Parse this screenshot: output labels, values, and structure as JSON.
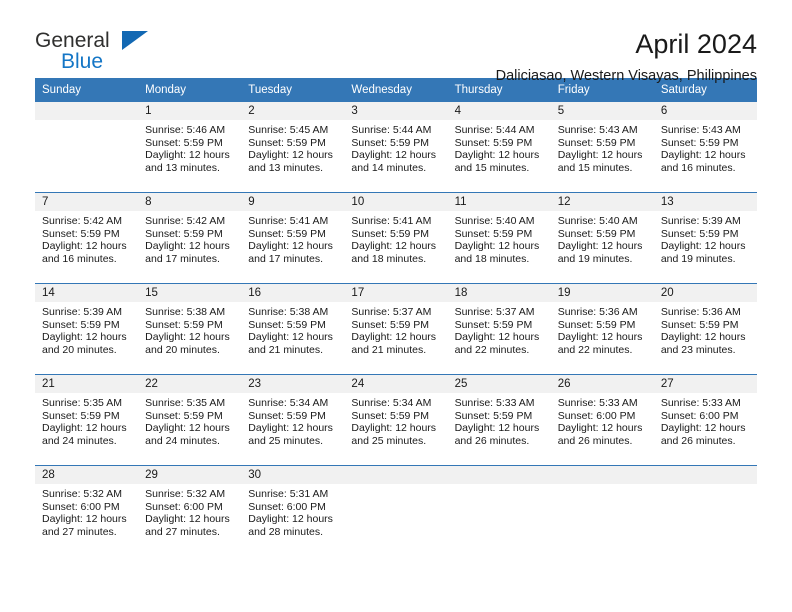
{
  "brand": {
    "name_top": "General",
    "name_bottom": "Blue",
    "accent_color": "#1476c6",
    "triangle_color": "#1268b3"
  },
  "header": {
    "title": "April 2024",
    "subtitle": "Daliciasao, Western Visayas, Philippines"
  },
  "calendar": {
    "header_bg": "#3477b6",
    "daynum_bg": "#f1f1f1",
    "weekday_headers": [
      "Sunday",
      "Monday",
      "Tuesday",
      "Wednesday",
      "Thursday",
      "Friday",
      "Saturday"
    ],
    "weeks": [
      [
        {
          "day": "",
          "sunrise": "",
          "sunset": "",
          "daylight1": "",
          "daylight2": ""
        },
        {
          "day": "1",
          "sunrise": "Sunrise: 5:46 AM",
          "sunset": "Sunset: 5:59 PM",
          "daylight1": "Daylight: 12 hours",
          "daylight2": "and 13 minutes."
        },
        {
          "day": "2",
          "sunrise": "Sunrise: 5:45 AM",
          "sunset": "Sunset: 5:59 PM",
          "daylight1": "Daylight: 12 hours",
          "daylight2": "and 13 minutes."
        },
        {
          "day": "3",
          "sunrise": "Sunrise: 5:44 AM",
          "sunset": "Sunset: 5:59 PM",
          "daylight1": "Daylight: 12 hours",
          "daylight2": "and 14 minutes."
        },
        {
          "day": "4",
          "sunrise": "Sunrise: 5:44 AM",
          "sunset": "Sunset: 5:59 PM",
          "daylight1": "Daylight: 12 hours",
          "daylight2": "and 15 minutes."
        },
        {
          "day": "5",
          "sunrise": "Sunrise: 5:43 AM",
          "sunset": "Sunset: 5:59 PM",
          "daylight1": "Daylight: 12 hours",
          "daylight2": "and 15 minutes."
        },
        {
          "day": "6",
          "sunrise": "Sunrise: 5:43 AM",
          "sunset": "Sunset: 5:59 PM",
          "daylight1": "Daylight: 12 hours",
          "daylight2": "and 16 minutes."
        }
      ],
      [
        {
          "day": "7",
          "sunrise": "Sunrise: 5:42 AM",
          "sunset": "Sunset: 5:59 PM",
          "daylight1": "Daylight: 12 hours",
          "daylight2": "and 16 minutes."
        },
        {
          "day": "8",
          "sunrise": "Sunrise: 5:42 AM",
          "sunset": "Sunset: 5:59 PM",
          "daylight1": "Daylight: 12 hours",
          "daylight2": "and 17 minutes."
        },
        {
          "day": "9",
          "sunrise": "Sunrise: 5:41 AM",
          "sunset": "Sunset: 5:59 PM",
          "daylight1": "Daylight: 12 hours",
          "daylight2": "and 17 minutes."
        },
        {
          "day": "10",
          "sunrise": "Sunrise: 5:41 AM",
          "sunset": "Sunset: 5:59 PM",
          "daylight1": "Daylight: 12 hours",
          "daylight2": "and 18 minutes."
        },
        {
          "day": "11",
          "sunrise": "Sunrise: 5:40 AM",
          "sunset": "Sunset: 5:59 PM",
          "daylight1": "Daylight: 12 hours",
          "daylight2": "and 18 minutes."
        },
        {
          "day": "12",
          "sunrise": "Sunrise: 5:40 AM",
          "sunset": "Sunset: 5:59 PM",
          "daylight1": "Daylight: 12 hours",
          "daylight2": "and 19 minutes."
        },
        {
          "day": "13",
          "sunrise": "Sunrise: 5:39 AM",
          "sunset": "Sunset: 5:59 PM",
          "daylight1": "Daylight: 12 hours",
          "daylight2": "and 19 minutes."
        }
      ],
      [
        {
          "day": "14",
          "sunrise": "Sunrise: 5:39 AM",
          "sunset": "Sunset: 5:59 PM",
          "daylight1": "Daylight: 12 hours",
          "daylight2": "and 20 minutes."
        },
        {
          "day": "15",
          "sunrise": "Sunrise: 5:38 AM",
          "sunset": "Sunset: 5:59 PM",
          "daylight1": "Daylight: 12 hours",
          "daylight2": "and 20 minutes."
        },
        {
          "day": "16",
          "sunrise": "Sunrise: 5:38 AM",
          "sunset": "Sunset: 5:59 PM",
          "daylight1": "Daylight: 12 hours",
          "daylight2": "and 21 minutes."
        },
        {
          "day": "17",
          "sunrise": "Sunrise: 5:37 AM",
          "sunset": "Sunset: 5:59 PM",
          "daylight1": "Daylight: 12 hours",
          "daylight2": "and 21 minutes."
        },
        {
          "day": "18",
          "sunrise": "Sunrise: 5:37 AM",
          "sunset": "Sunset: 5:59 PM",
          "daylight1": "Daylight: 12 hours",
          "daylight2": "and 22 minutes."
        },
        {
          "day": "19",
          "sunrise": "Sunrise: 5:36 AM",
          "sunset": "Sunset: 5:59 PM",
          "daylight1": "Daylight: 12 hours",
          "daylight2": "and 22 minutes."
        },
        {
          "day": "20",
          "sunrise": "Sunrise: 5:36 AM",
          "sunset": "Sunset: 5:59 PM",
          "daylight1": "Daylight: 12 hours",
          "daylight2": "and 23 minutes."
        }
      ],
      [
        {
          "day": "21",
          "sunrise": "Sunrise: 5:35 AM",
          "sunset": "Sunset: 5:59 PM",
          "daylight1": "Daylight: 12 hours",
          "daylight2": "and 24 minutes."
        },
        {
          "day": "22",
          "sunrise": "Sunrise: 5:35 AM",
          "sunset": "Sunset: 5:59 PM",
          "daylight1": "Daylight: 12 hours",
          "daylight2": "and 24 minutes."
        },
        {
          "day": "23",
          "sunrise": "Sunrise: 5:34 AM",
          "sunset": "Sunset: 5:59 PM",
          "daylight1": "Daylight: 12 hours",
          "daylight2": "and 25 minutes."
        },
        {
          "day": "24",
          "sunrise": "Sunrise: 5:34 AM",
          "sunset": "Sunset: 5:59 PM",
          "daylight1": "Daylight: 12 hours",
          "daylight2": "and 25 minutes."
        },
        {
          "day": "25",
          "sunrise": "Sunrise: 5:33 AM",
          "sunset": "Sunset: 5:59 PM",
          "daylight1": "Daylight: 12 hours",
          "daylight2": "and 26 minutes."
        },
        {
          "day": "26",
          "sunrise": "Sunrise: 5:33 AM",
          "sunset": "Sunset: 6:00 PM",
          "daylight1": "Daylight: 12 hours",
          "daylight2": "and 26 minutes."
        },
        {
          "day": "27",
          "sunrise": "Sunrise: 5:33 AM",
          "sunset": "Sunset: 6:00 PM",
          "daylight1": "Daylight: 12 hours",
          "daylight2": "and 26 minutes."
        }
      ],
      [
        {
          "day": "28",
          "sunrise": "Sunrise: 5:32 AM",
          "sunset": "Sunset: 6:00 PM",
          "daylight1": "Daylight: 12 hours",
          "daylight2": "and 27 minutes."
        },
        {
          "day": "29",
          "sunrise": "Sunrise: 5:32 AM",
          "sunset": "Sunset: 6:00 PM",
          "daylight1": "Daylight: 12 hours",
          "daylight2": "and 27 minutes."
        },
        {
          "day": "30",
          "sunrise": "Sunrise: 5:31 AM",
          "sunset": "Sunset: 6:00 PM",
          "daylight1": "Daylight: 12 hours",
          "daylight2": "and 28 minutes."
        },
        {
          "day": "",
          "sunrise": "",
          "sunset": "",
          "daylight1": "",
          "daylight2": ""
        },
        {
          "day": "",
          "sunrise": "",
          "sunset": "",
          "daylight1": "",
          "daylight2": ""
        },
        {
          "day": "",
          "sunrise": "",
          "sunset": "",
          "daylight1": "",
          "daylight2": ""
        },
        {
          "day": "",
          "sunrise": "",
          "sunset": "",
          "daylight1": "",
          "daylight2": ""
        }
      ]
    ]
  }
}
